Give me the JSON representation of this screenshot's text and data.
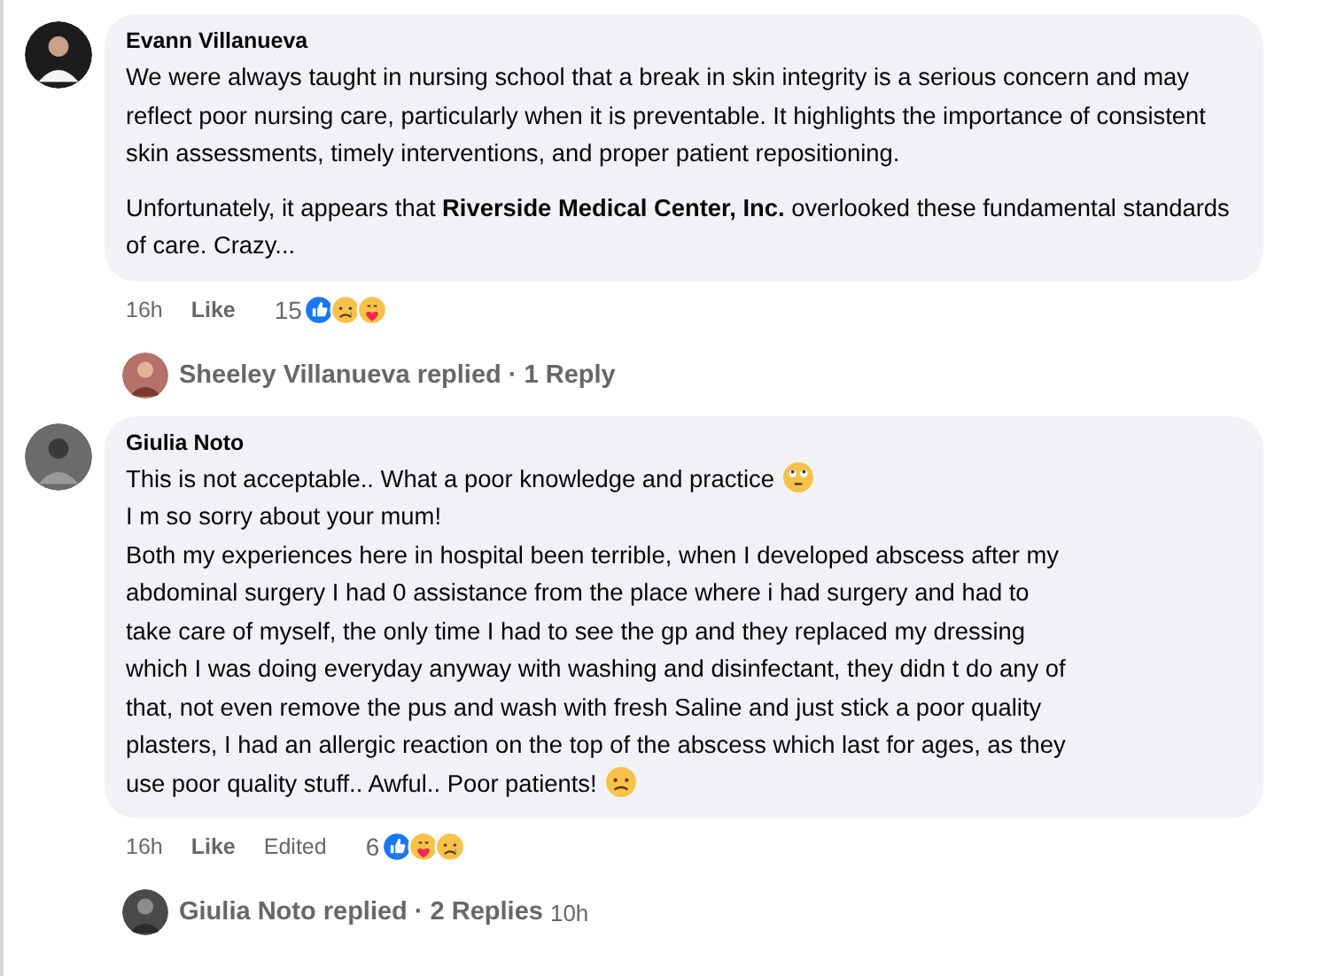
{
  "comments": [
    {
      "author": "Evann Villanueva",
      "paragraphs": [
        {
          "text": "We were always taught in nursing school that a break in skin integrity is a serious concern and may reflect poor nursing care, particularly when it is preventable. It highlights the importance of consistent skin assessments, timely interventions, and proper patient repositioning."
        },
        {
          "text": "Unfortunately, it appears that **Riverside Medical Center, Inc.** overlooked these fundamental standards of care. Crazy..."
        }
      ],
      "time": "16h",
      "like": "Like",
      "count": "15",
      "reactions": [
        {
          "kind": "like"
        },
        {
          "kind": "sad"
        },
        {
          "kind": "care"
        }
      ],
      "replies": {
        "text": "Sheeley Villanueva replied · 1 Reply"
      }
    },
    {
      "author": "Giulia Noto",
      "lines": [
        {
          "text": "This is not acceptable.. What a poor knowledge and practice",
          "emoji": {
            "kind": "dizzy"
          }
        },
        {
          "text": "I m so sorry about your mum!"
        },
        {
          "text": "Both my experiences here in hospital been terrible, when I developed abscess after my"
        },
        {
          "text": "abdominal surgery I had 0 assistance from the place where i had surgery and had to"
        },
        {
          "text": "take care of myself, the only time I had to see the gp and they replaced my dressing"
        },
        {
          "text": "which I was doing everyday anyway with washing and disinfectant, they didn t do any of"
        },
        {
          "text": "that, not even remove the pus and wash with fresh Saline and just stick a poor quality"
        },
        {
          "text": "plasters, I had an allergic reaction on the top of the abscess which last for ages, as they"
        },
        {
          "text": "use poor quality stuff.. Awful.. Poor patients!",
          "emoji": {
            "kind": "sad"
          }
        }
      ],
      "time": "16h",
      "like": "Like",
      "edited": "Edited",
      "count": "6",
      "reactions": [
        {
          "kind": "like"
        },
        {
          "kind": "care"
        },
        {
          "kind": "sad"
        }
      ],
      "replies": {
        "text": "Giulia Noto replied · 2 Replies",
        "time": "10h"
      }
    }
  ]
}
